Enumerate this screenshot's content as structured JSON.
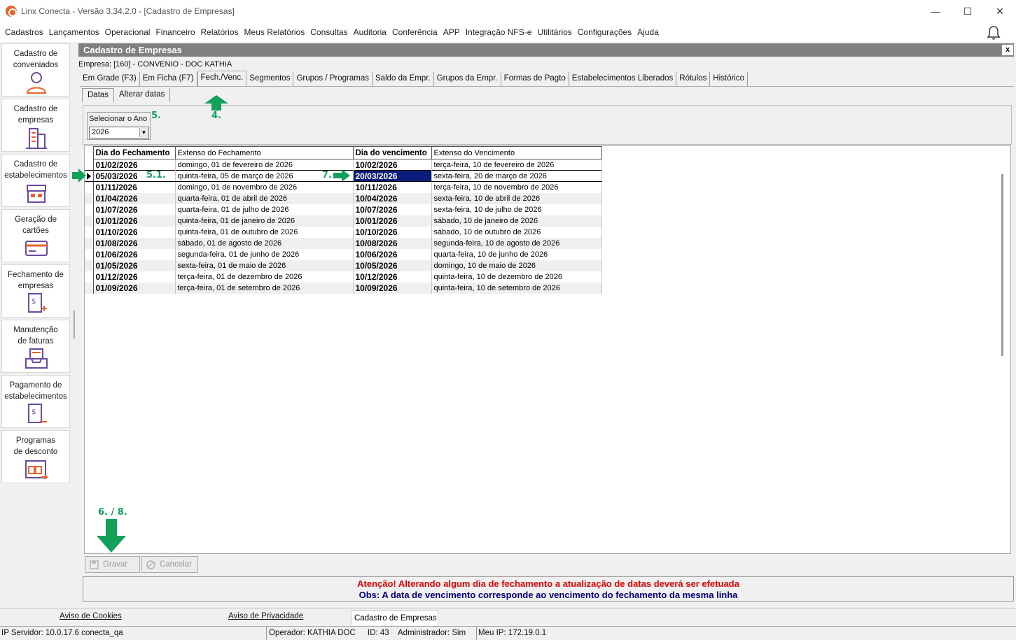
{
  "window": {
    "title": "Linx Conecta - Versão 3.34.2.0 - [Cadastro de Empresas]",
    "controls": {
      "minimize": "—",
      "maximize": "☐",
      "close": "✕"
    }
  },
  "menubar": {
    "items": [
      "Cadastros",
      "Lançamentos",
      "Operacional",
      "Financeiro",
      "Relatórios",
      "Meus Relatórios",
      "Consultas",
      "Auditoria",
      "Conferência",
      "APP",
      "Integração NFS-e",
      "Utilitários",
      "Configurações",
      "Ajuda"
    ]
  },
  "sidebar": {
    "items": [
      {
        "label1": "Cadastro de",
        "label2": "conveniados",
        "icon": "person-icon"
      },
      {
        "label1": "Cadastro de",
        "label2": "empresas",
        "icon": "building-icon"
      },
      {
        "label1": "Cadastro de",
        "label2": "estabelecimentos",
        "icon": "store-icon"
      },
      {
        "label1": "Geração de",
        "label2": "cartões",
        "icon": "card-icon"
      },
      {
        "label1": "Fechamento de",
        "label2": "empresas",
        "icon": "invoice-add-icon"
      },
      {
        "label1": "Manutenção",
        "label2": "de faturas",
        "icon": "tray-icon"
      },
      {
        "label1": "Pagamento de",
        "label2": "estabelecimentos",
        "icon": "payment-icon"
      },
      {
        "label1": "Programas",
        "label2": "de desconto",
        "icon": "discount-icon"
      }
    ]
  },
  "form": {
    "title": "Cadastro de Empresas",
    "close_label": "x",
    "empresa": "Empresa: [160] - CONVENIO - DOC KATHIA",
    "tabs": [
      "Em Grade (F3)",
      "Em Ficha (F7)",
      "Fech./Venc.",
      "Segmentos",
      "Grupos / Programas",
      "Saldo da Empr.",
      "Grupos da Empr.",
      "Formas de Pagto",
      "Estabelecimentos Liberados",
      "Rótulos",
      "Histórico"
    ],
    "active_tab": "Fech./Venc.",
    "subtabs": [
      "Datas",
      "Alterar datas"
    ],
    "year": {
      "label": "Selecionar o Ano",
      "value": "2026",
      "arrow": "▼"
    },
    "grid": {
      "columns": [
        "Dia do Fechamento",
        "Extenso do Fechamento",
        "Dia do vencimento",
        "Extenso do Vencimento"
      ],
      "rows": [
        [
          "01/02/2026",
          "domingo, 01 de fevereiro de 2026",
          "10/02/2026",
          "terça-feira, 10 de fevereiro de 2026"
        ],
        [
          "05/03/2026",
          "quinta-feira, 05 de março de 2026",
          "20/03/2026",
          "sexta-feira, 20 de março de 2026"
        ],
        [
          "01/11/2026",
          "domingo, 01 de novembro de 2026",
          "10/11/2026",
          "terça-feira, 10 de novembro de 2026"
        ],
        [
          "01/04/2026",
          "quarta-feira, 01 de abril de 2026",
          "10/04/2026",
          "sexta-feira, 10 de abril de 2026"
        ],
        [
          "01/07/2026",
          "quarta-feira, 01 de julho de 2026",
          "10/07/2026",
          "sexta-feira, 10 de julho de 2026"
        ],
        [
          "01/01/2026",
          "quinta-feira, 01 de janeiro de 2026",
          "10/01/2026",
          "sábado, 10 de janeiro de 2026"
        ],
        [
          "01/10/2026",
          "quinta-feira, 01 de outubro de 2026",
          "10/10/2026",
          "sábado, 10 de outubro de 2026"
        ],
        [
          "01/08/2026",
          "sábado, 01 de agosto de 2026",
          "10/08/2026",
          "segunda-feira, 10 de agosto de 2026"
        ],
        [
          "01/06/2026",
          "segunda-feira, 01 de junho de 2026",
          "10/06/2026",
          "quarta-feira, 10 de junho de 2026"
        ],
        [
          "01/05/2026",
          "sexta-feira, 01 de maio de 2026",
          "10/05/2026",
          "domingo, 10 de maio de 2026"
        ],
        [
          "01/12/2026",
          "terça-feira, 01 de dezembro de 2026",
          "10/12/2026",
          "quinta-feira, 10 de dezembro de 2026"
        ],
        [
          "01/09/2026",
          "terça-feira, 01 de setembro de 2026",
          "10/09/2026",
          "quinta-feira, 10 de setembro de 2026"
        ]
      ],
      "selected_row": 1
    },
    "buttons": {
      "save": "Gravar",
      "cancel": "Cancelar"
    },
    "messages": {
      "line1": "Atenção! Alterando algum dia de fechamento a  atualização de datas deverá ser efetuada",
      "line2": "Obs:  A data de vencimento corresponde ao vencimento do fechamento da mesma linha"
    }
  },
  "annotations": {
    "a4": "4.",
    "a5": "5.",
    "a51": "5.1.",
    "a7": "7.",
    "a68": "6. / 8.",
    "color": "#12a05a"
  },
  "footer": {
    "cookies": "Aviso de Cookies",
    "privacy": "Aviso de Privacidade",
    "open_tab": "Cadastro de Empresas"
  },
  "status": {
    "server": "IP Servidor: 10.0.17.6 conecta_qa",
    "operator": "Operador: KATHIA DOC",
    "id": "ID: 43",
    "admin": "Administrador: Sim",
    "ip": "Meu IP: 172.19.0.1"
  },
  "colors": {
    "selection": "#0a1d7a",
    "header": "#808080",
    "alert": "#e00000",
    "obs": "#00007a",
    "brand": "#e8622c"
  }
}
